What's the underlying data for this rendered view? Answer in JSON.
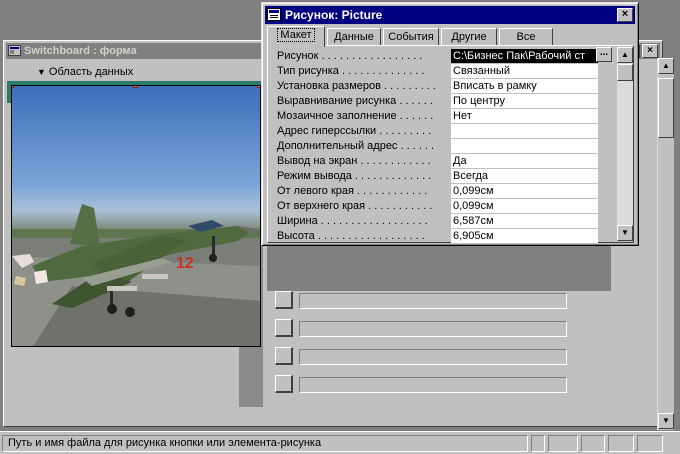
{
  "form_window": {
    "title": "Switchboard : форма",
    "section_label": "Область данных",
    "buttons": {
      "minimize": "_",
      "maximize": "□",
      "close": "×"
    }
  },
  "property_sheet": {
    "title": "Рисунок: Picture",
    "close_label": "×",
    "builder_label": "...",
    "tabs": [
      {
        "label": "Макет",
        "active": true
      },
      {
        "label": "Данные",
        "active": false
      },
      {
        "label": "События",
        "active": false
      },
      {
        "label": "Другие",
        "active": false
      },
      {
        "label": "Все",
        "active": false
      }
    ],
    "properties": [
      {
        "label": "Рисунок . . . . . . . . . . . . . . . . .",
        "value": "C:\\Бизнес Пак\\Рабочий ст"
      },
      {
        "label": "Тип рисунка . . . . . . . . . . . . . .",
        "value": "Связанный"
      },
      {
        "label": "Установка размеров . . . . . . . . .",
        "value": "Вписать в рамку"
      },
      {
        "label": "Выравнивание рисунка . . . . . .",
        "value": "По центру"
      },
      {
        "label": "Мозаичное заполнение . . . . . .",
        "value": "Нет"
      },
      {
        "label": "Адрес гиперссылки . . . . . . . . .",
        "value": ""
      },
      {
        "label": "Дополнительный адрес . . . . . .",
        "value": ""
      },
      {
        "label": "Вывод на экран . . . . . . . . . . . .",
        "value": "Да"
      },
      {
        "label": "Режим вывода . . . . . . . . . . . . .",
        "value": "Всегда"
      },
      {
        "label": "От левого края . . . . . . . . . . . .",
        "value": "0,099см"
      },
      {
        "label": "От верхнего края . . . . . . . . . . .",
        "value": "0,099см"
      },
      {
        "label": "Ширина . . . . . . . . . . . . . . . . . .",
        "value": "6,587см"
      },
      {
        "label": "Высота . . . . . . . . . . . . . . . . . .",
        "value": "6,905см"
      }
    ]
  },
  "statusbar": {
    "text": "Путь и имя файла для рисунка кнопки или элемента-рисунка"
  },
  "picture": {
    "icon": "jet-aircraft-photo",
    "tail_marking": "12"
  },
  "colors": {
    "titlebar_active": "#000080",
    "titlebar_inactive": "#808080",
    "face": "#c0c0c0",
    "selection": "#000000"
  }
}
